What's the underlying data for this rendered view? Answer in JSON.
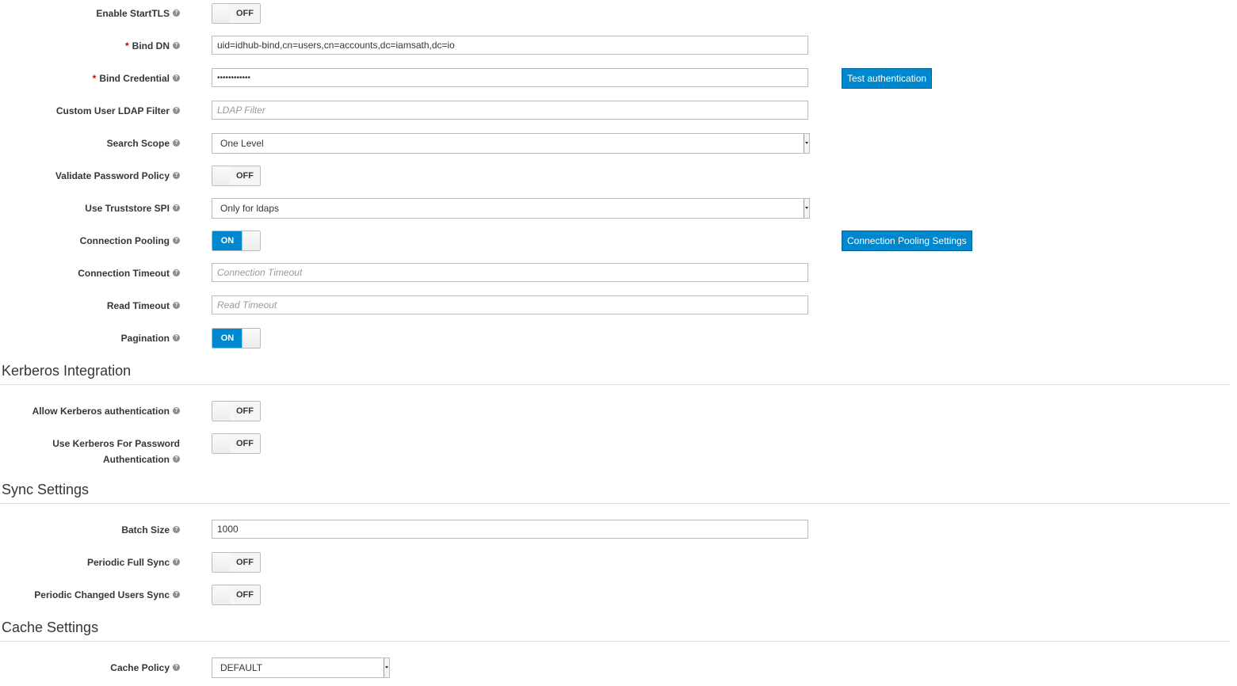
{
  "rows": {
    "starttls": {
      "label": "Enable StartTLS",
      "state": "OFF"
    },
    "binddn": {
      "label": "Bind DN",
      "required": "*",
      "value": "uid=idhub-bind,cn=users,cn=accounts,dc=iamsath,dc=io"
    },
    "bindcred": {
      "label": "Bind Credential",
      "required": "*",
      "value": "••••••••••••",
      "button": "Test authentication"
    },
    "ldapfilter": {
      "label": "Custom User LDAP Filter",
      "placeholder": "LDAP Filter"
    },
    "searchscope": {
      "label": "Search Scope",
      "selected": "One Level"
    },
    "validatepw": {
      "label": "Validate Password Policy",
      "state": "OFF"
    },
    "truststore": {
      "label": "Use Truststore SPI",
      "selected": "Only for ldaps"
    },
    "pooling": {
      "label": "Connection Pooling",
      "state": "ON",
      "button": "Connection Pooling Settings"
    },
    "conntimeout": {
      "label": "Connection Timeout",
      "placeholder": "Connection Timeout"
    },
    "readtimeout": {
      "label": "Read Timeout",
      "placeholder": "Read Timeout"
    },
    "pagination": {
      "label": "Pagination",
      "state": "ON"
    },
    "allowkerb": {
      "label": "Allow Kerberos authentication",
      "state": "OFF"
    },
    "kerbpw": {
      "label_line1": "Use Kerberos For Password",
      "label_line2": "Authentication",
      "state": "OFF"
    },
    "batchsize": {
      "label": "Batch Size",
      "value": "1000"
    },
    "fullsync": {
      "label": "Periodic Full Sync",
      "state": "OFF"
    },
    "changedsync": {
      "label": "Periodic Changed Users Sync",
      "state": "OFF"
    },
    "cachepolicy": {
      "label": "Cache Policy",
      "selected": "DEFAULT"
    }
  },
  "sections": {
    "kerberos": "Kerberos Integration",
    "sync": "Sync Settings",
    "cache": "Cache Settings"
  },
  "help_glyph": "?",
  "colors": {
    "accent": "#0088ce",
    "required": "#cc0000"
  },
  "icons": {
    "help": "question-circle-icon",
    "caret": "caret-down-icon"
  }
}
